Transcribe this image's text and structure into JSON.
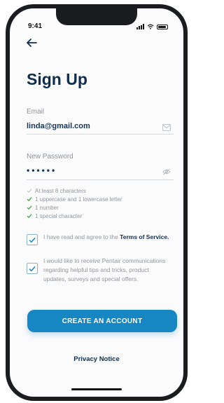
{
  "status_bar": {
    "time": "9:41",
    "signal_icon": "cellular-signal-icon",
    "wifi_icon": "wifi-icon",
    "battery_icon": "battery-icon"
  },
  "nav": {
    "back_icon": "back-arrow-icon"
  },
  "title": "Sign Up",
  "email": {
    "label": "Email",
    "value": "linda@gmail.com",
    "icon": "envelope-icon"
  },
  "password": {
    "label": "New Password",
    "value": "••••••",
    "icon": "eye-hidden-icon"
  },
  "requirements": [
    {
      "label": "At least 8 characters",
      "met": false
    },
    {
      "label": "1 uppercase and 1 lowercase letter",
      "met": true
    },
    {
      "label": "1 number",
      "met": true
    },
    {
      "label": "1 special character",
      "met": true
    }
  ],
  "agree_terms": {
    "checked": true,
    "text": "I have read and agree to the ",
    "link": "Terms of Service."
  },
  "marketing": {
    "checked": true,
    "text": "I would like to receive Pentair communications regarding helpful tips and tricks, product updates, surveys and special offers."
  },
  "cta_label": "CREATE AN ACCOUNT",
  "privacy_label": "Privacy Notice",
  "colors": {
    "brand_navy": "#0f2d4f",
    "accent_blue": "#1787c4",
    "success_green": "#3aa53a",
    "muted_gray": "#8f969c"
  }
}
